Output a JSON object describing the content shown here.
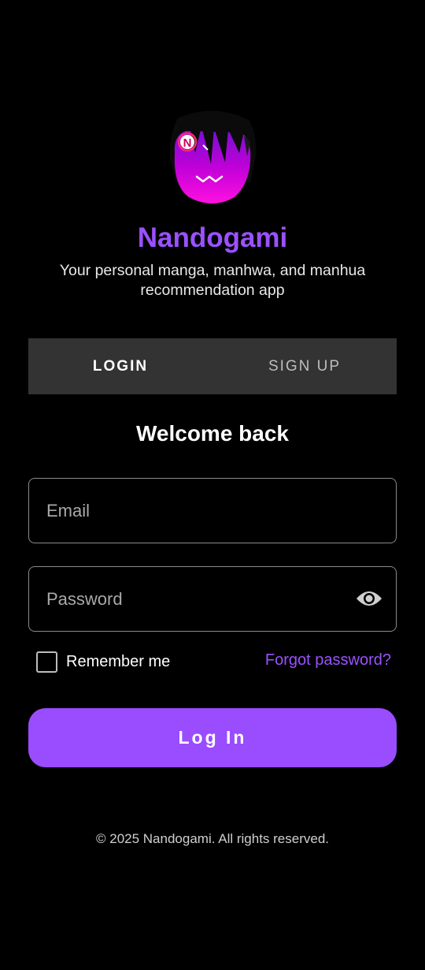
{
  "app": {
    "name": "Nandogami",
    "subtitle": "Your personal manga, manhwa, and manhua recommendation app",
    "logo_icon": "anime-girl-logo-icon"
  },
  "tabs": [
    {
      "label": "LOGIN",
      "active": true
    },
    {
      "label": "SIGN UP",
      "active": false
    }
  ],
  "form": {
    "heading": "Welcome back",
    "email": {
      "placeholder": "Email",
      "value": ""
    },
    "password": {
      "placeholder": "Password",
      "value": "",
      "toggle_icon": "eye-icon"
    },
    "remember_label": "Remember me",
    "remember_checked": false,
    "forgot_label": "Forgot password?",
    "submit_label": "Log In"
  },
  "footer": {
    "text": "© 2025 Nandogami. All rights reserved."
  },
  "colors": {
    "accent": "#9a4cff",
    "link": "#9b51ff",
    "background": "#000000",
    "tab_bar": "#333333",
    "logo_magenta": "#e600d6"
  }
}
